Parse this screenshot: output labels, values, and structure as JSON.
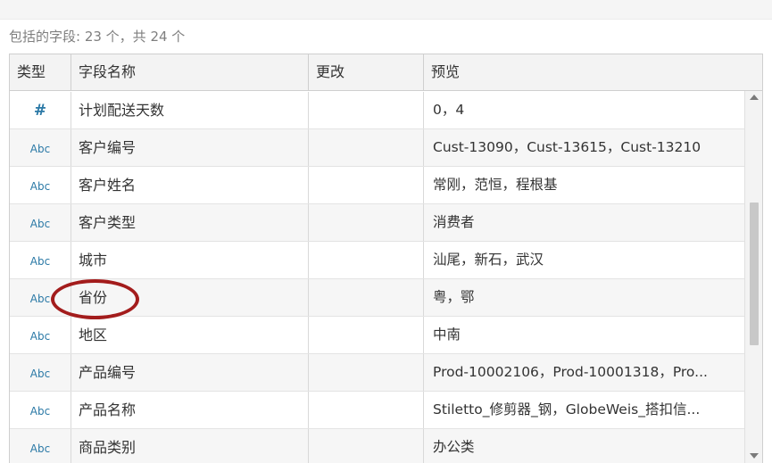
{
  "summary": "包括的字段: 23 个，共 24 个",
  "columns": {
    "type": "类型",
    "name": "字段名称",
    "change": "更改",
    "preview": "预览"
  },
  "rows": [
    {
      "type_icon": "#",
      "type_icon_name": "number-type-icon",
      "name": "计划配送天数",
      "change": "",
      "preview": "0，4"
    },
    {
      "type_icon": "Abc",
      "type_icon_name": "string-type-icon",
      "name": "客户编号",
      "change": "",
      "preview": "Cust-13090，Cust-13615，Cust-13210"
    },
    {
      "type_icon": "Abc",
      "type_icon_name": "string-type-icon",
      "name": "客户姓名",
      "change": "",
      "preview": "常刚，范恒，程根基"
    },
    {
      "type_icon": "Abc",
      "type_icon_name": "string-type-icon",
      "name": "客户类型",
      "change": "",
      "preview": "消费者"
    },
    {
      "type_icon": "Abc",
      "type_icon_name": "string-type-icon",
      "name": "城市",
      "change": "",
      "preview": "汕尾，新石，武汉"
    },
    {
      "type_icon": "Abc",
      "type_icon_name": "string-type-icon",
      "name": "省份",
      "change": "",
      "preview": "粤，鄂"
    },
    {
      "type_icon": "Abc",
      "type_icon_name": "string-type-icon",
      "name": "地区",
      "change": "",
      "preview": "中南"
    },
    {
      "type_icon": "Abc",
      "type_icon_name": "string-type-icon",
      "name": "产品编号",
      "change": "",
      "preview": "Prod-10002106，Prod-10001318，Pro..."
    },
    {
      "type_icon": "Abc",
      "type_icon_name": "string-type-icon",
      "name": "产品名称",
      "change": "",
      "preview": "Stiletto_修剪器_钢，GlobeWeis_搭扣信..."
    },
    {
      "type_icon": "Abc",
      "type_icon_name": "string-type-icon",
      "name": "商品类别",
      "change": "",
      "preview": "办公类"
    }
  ],
  "colors": {
    "type_icon": "#2b79a6",
    "annotation": "#a31c1c",
    "header_bg": "#f3f3f3",
    "alt_row_bg": "#f6f6f6"
  }
}
